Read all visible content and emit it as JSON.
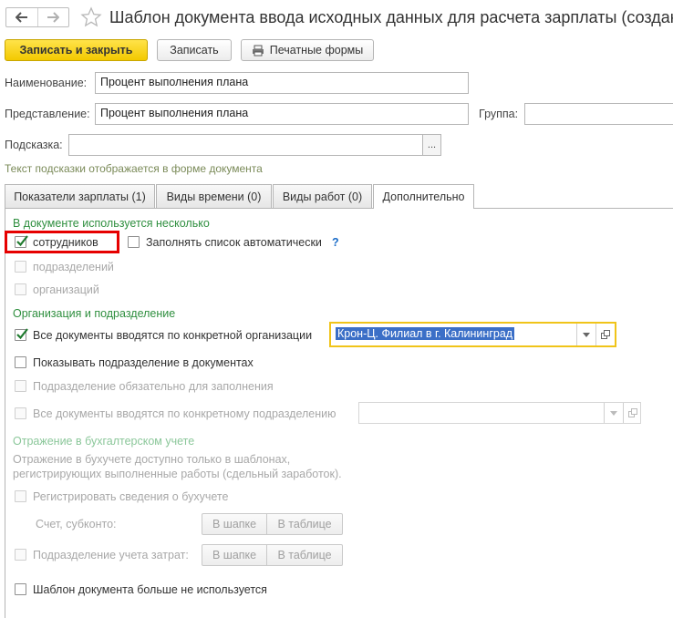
{
  "window": {
    "title": "Шаблон документа ввода исходных данных для расчета зарплаты (создание)"
  },
  "toolbar": {
    "save_close": "Записать и закрыть",
    "save": "Записать",
    "print": "Печатные формы"
  },
  "form": {
    "name_label": "Наименование:",
    "name_value": "Процент выполнения плана",
    "repr_label": "Представление:",
    "repr_value": "Процент выполнения плана",
    "group_label": "Группа:",
    "group_value": "",
    "hint_label": "Подсказка:",
    "hint_value": "",
    "hint_button": "...",
    "hint_note": "Текст подсказки отображается в форме документа"
  },
  "tabs": [
    {
      "label": "Показатели зарплаты (1)"
    },
    {
      "label": "Виды времени (0)"
    },
    {
      "label": "Виды работ (0)"
    },
    {
      "label": "Дополнительно"
    }
  ],
  "active_tab": "Дополнительно",
  "section_multi": {
    "title": "В документе используется несколько",
    "employees": {
      "label": "сотрудников",
      "checked": true
    },
    "auto_fill": {
      "label": "Заполнять список автоматически",
      "checked": false
    },
    "help": "?",
    "departments": {
      "label": "подразделений",
      "checked": false,
      "disabled": true
    },
    "organizations": {
      "label": "организаций",
      "checked": false,
      "disabled": true
    }
  },
  "section_org": {
    "title": "Организация и подразделение",
    "by_org": {
      "label": "Все документы вводятся по конкретной организации",
      "checked": true
    },
    "org_value": "Крон-Ц. Филиал в г. Калининград",
    "show_dept": {
      "label": "Показывать подразделение в документах",
      "checked": false
    },
    "dept_required": {
      "label": "Подразделение обязательно для заполнения",
      "checked": false,
      "disabled": true
    },
    "by_dept": {
      "label": "Все документы вводятся по конкретному подразделению",
      "checked": false,
      "disabled": true
    },
    "dept_value": ""
  },
  "section_acc": {
    "title": "Отражение в бухгалтерском учете",
    "note_line1": "Отражение в бухучете доступно только в шаблонах,",
    "note_line2": "регистрирующих выполненные работы (сдельный заработок).",
    "register": {
      "label": "Регистрировать сведения о бухучете",
      "checked": false,
      "disabled": true
    },
    "account_label": "Счет, субконто:",
    "cost_dept": {
      "label": "Подразделение учета затрат:",
      "checked": false,
      "disabled": true
    },
    "in_header": "В шапке",
    "in_table": "В таблице"
  },
  "template_unused": {
    "label": "Шаблон документа больше не используется",
    "checked": false
  },
  "colors": {
    "accent_yellow": "#f3c900",
    "group_green": "#2f8f3f",
    "highlight_red": "#e60000",
    "selection_blue": "#3b6fc7"
  }
}
